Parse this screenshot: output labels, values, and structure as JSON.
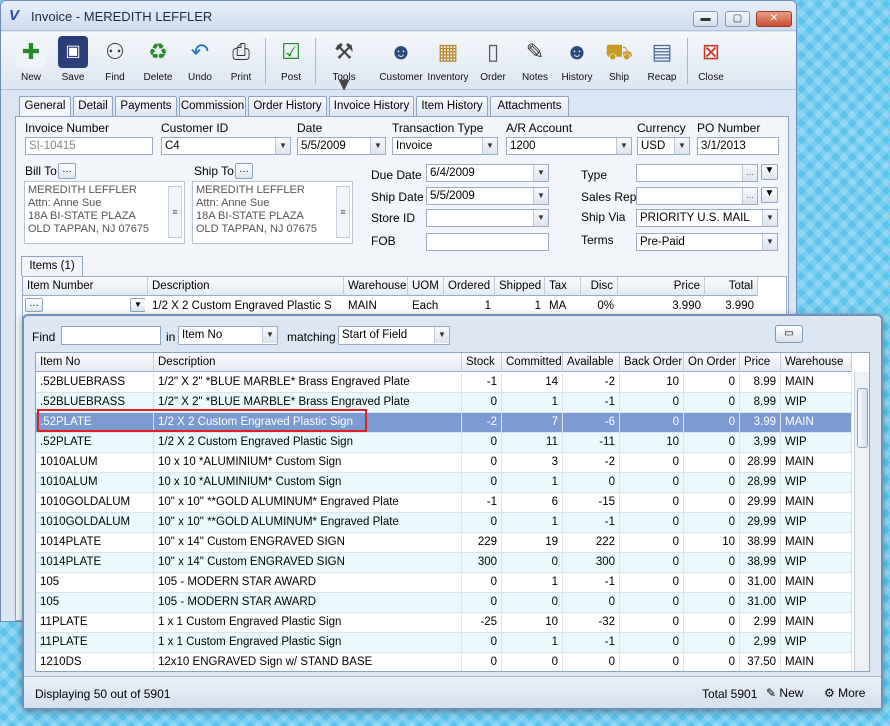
{
  "window": {
    "title": "Invoice - MEREDITH LEFFLER"
  },
  "toolbar": {
    "items": [
      "New",
      "Save",
      "Find",
      "Delete",
      "Undo",
      "Print",
      "Post",
      "Tools",
      "Customer",
      "Inventory",
      "Order",
      "Notes",
      "History",
      "Ship",
      "Recap",
      "Close"
    ]
  },
  "tabs": [
    "General",
    "Detail",
    "Payments",
    "Commission",
    "Order History",
    "Invoice History",
    "Item History",
    "Attachments"
  ],
  "form": {
    "invoice_number_label": "Invoice Number",
    "invoice_number": "SI-10415",
    "customer_id_label": "Customer ID",
    "customer_id": "C4",
    "date_label": "Date",
    "date": "5/5/2009",
    "transaction_type_label": "Transaction Type",
    "transaction_type": "Invoice",
    "ar_account_label": "A/R Account",
    "ar_account": "1200",
    "currency_label": "Currency",
    "currency": "USD",
    "po_number_label": "PO Number",
    "po_number": "3/1/2013",
    "bill_to_label": "Bill To",
    "ship_to_label": "Ship To",
    "bill_to": [
      "MEREDITH LEFFLER",
      "Attn: Anne Sue",
      "18A BI-STATE PLAZA",
      "OLD TAPPAN, NJ 07675"
    ],
    "ship_to": [
      "MEREDITH LEFFLER",
      "Attn: Anne Sue",
      "18A BI-STATE PLAZA",
      "OLD TAPPAN, NJ 07675"
    ],
    "due_date_label": "Due Date",
    "due_date": "6/4/2009",
    "ship_date_label": "Ship Date",
    "ship_date": "5/5/2009",
    "store_id_label": "Store ID",
    "fob_label": "FOB",
    "type_label": "Type",
    "sales_rep_label": "Sales Rep",
    "ship_via_label": "Ship Via",
    "ship_via": "PRIORITY U.S. MAIL",
    "terms_label": "Terms",
    "terms": "Pre-Paid"
  },
  "items": {
    "tab_label": "Items (1)",
    "headers": [
      "Item Number",
      "Description",
      "Warehouse",
      "UOM",
      "Ordered",
      "Shipped",
      "Tax",
      "Disc",
      "Price",
      "Total"
    ],
    "row": {
      "description": "1/2 X 2 Custom Engraved Plastic S",
      "warehouse": "MAIN",
      "uom": "Each",
      "ordered": "1",
      "shipped": "1",
      "tax": "MA",
      "disc": "0%",
      "price": "3.990",
      "total": "3.990"
    }
  },
  "lookup": {
    "find_label": "Find",
    "in_label": "in",
    "in_value": "Item No",
    "matching_label": "matching",
    "matching_value": "Start of Field",
    "headers": [
      "Item No",
      "Description",
      "Stock",
      "Committed",
      "Available",
      "Back Order",
      "On Order",
      "Price",
      "Warehouse"
    ],
    "rows": [
      [
        ".52BLUEBRASS",
        "1/2\" X 2\"  *BLUE MARBLE*  Brass  Engraved Plate",
        "-1",
        "14",
        "-2",
        "10",
        "0",
        "8.99",
        "MAIN"
      ],
      [
        ".52BLUEBRASS",
        "1/2\" X 2\"  *BLUE MARBLE*  Brass  Engraved Plate",
        "0",
        "1",
        "-1",
        "0",
        "0",
        "8.99",
        "WIP"
      ],
      [
        ".52PLATE",
        "1/2  X  2  Custom Engraved Plastic Sign",
        "-2",
        "7",
        "-6",
        "0",
        "0",
        "3.99",
        "MAIN"
      ],
      [
        ".52PLATE",
        "1/2  X  2  Custom Engraved Plastic Sign",
        "0",
        "11",
        "-11",
        "10",
        "0",
        "3.99",
        "WIP"
      ],
      [
        "1010ALUM",
        "10 x 10 *ALUMINIUM* Custom Sign",
        "0",
        "3",
        "-2",
        "0",
        "0",
        "28.99",
        "MAIN"
      ],
      [
        "1010ALUM",
        "10 x 10 *ALUMINIUM* Custom Sign",
        "0",
        "1",
        "0",
        "0",
        "0",
        "28.99",
        "WIP"
      ],
      [
        "1010GOLDALUM",
        "10\" x 10\" **GOLD ALUMINUM* Engraved Plate",
        "-1",
        "6",
        "-15",
        "0",
        "0",
        "29.99",
        "MAIN"
      ],
      [
        "1010GOLDALUM",
        "10\" x 10\" **GOLD ALUMINUM* Engraved Plate",
        "0",
        "1",
        "-1",
        "0",
        "0",
        "29.99",
        "WIP"
      ],
      [
        "1014PLATE",
        "10\" x 14\"  Custom ENGRAVED SIGN",
        "229",
        "19",
        "222",
        "0",
        "10",
        "38.99",
        "MAIN"
      ],
      [
        "1014PLATE",
        "10\" x 14\"  Custom ENGRAVED SIGN",
        "300",
        "0",
        "300",
        "0",
        "0",
        "38.99",
        "WIP"
      ],
      [
        "105",
        "105 - MODERN STAR AWARD",
        "0",
        "1",
        "-1",
        "0",
        "0",
        "31.00",
        "MAIN"
      ],
      [
        "105",
        "105 - MODERN STAR AWARD",
        "0",
        "0",
        "0",
        "0",
        "0",
        "31.00",
        "WIP"
      ],
      [
        "11PLATE",
        "1 x 1  Custom Engraved Plastic Sign",
        "-25",
        "10",
        "-32",
        "0",
        "0",
        "2.99",
        "MAIN"
      ],
      [
        "11PLATE",
        "1 x 1  Custom Engraved Plastic Sign",
        "0",
        "1",
        "-1",
        "0",
        "0",
        "2.99",
        "WIP"
      ],
      [
        "1210DS",
        "12x10 ENGRAVED Sign w/ STAND BASE",
        "0",
        "0",
        "0",
        "0",
        "0",
        "37.50",
        "MAIN"
      ]
    ],
    "status": "Displaying 50 out of 5901",
    "total": "Total 5901",
    "new_label": "New",
    "more_label": "More"
  }
}
